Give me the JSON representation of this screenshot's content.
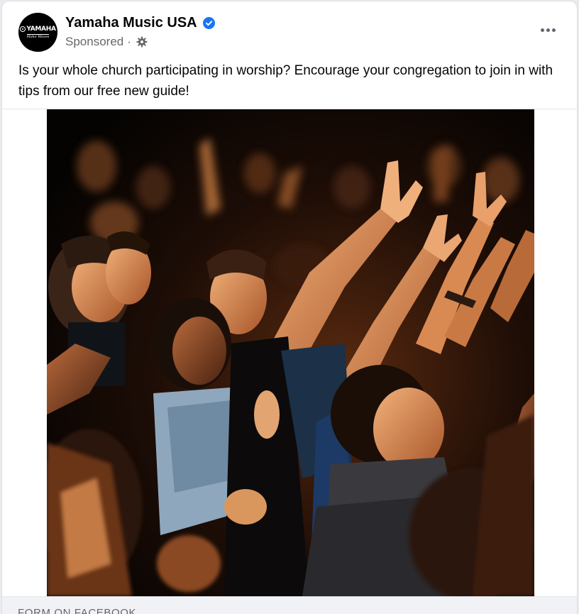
{
  "post": {
    "page_name": "Yamaha Music USA",
    "verified": true,
    "avatar": {
      "brand": "YAMAHA",
      "tagline": "Make Waves",
      "background": "#000000"
    },
    "sponsored_label": "Sponsored",
    "separator": "·",
    "privacy_icon": "gear-icon",
    "more_icon": "more-options-icon",
    "text": "Is your whole church participating in worship? Encourage your congregation to join in with tips from our free new guide!",
    "footer_label": "FORM ON FACEBOOK"
  },
  "colors": {
    "verified_badge": "#1877f2",
    "secondary_text": "#65676b",
    "primary_text": "#050505"
  }
}
